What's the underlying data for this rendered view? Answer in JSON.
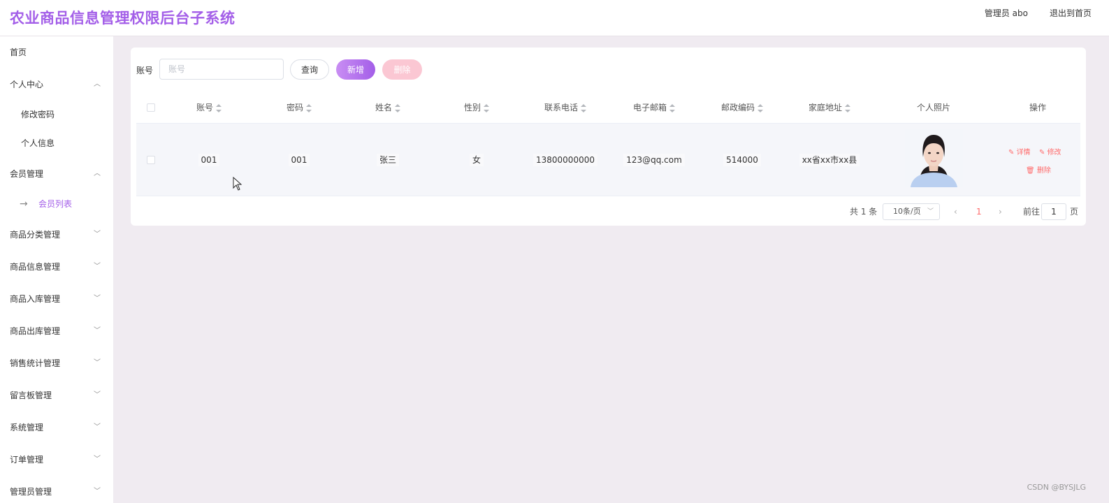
{
  "header": {
    "title": "农业商品信息管理权限后台子系统",
    "user": "管理员 abo",
    "logout": "退出到首页"
  },
  "sidebar": {
    "items": [
      {
        "label": "首页"
      },
      {
        "label": "个人中心",
        "children": [
          "修改密码",
          "个人信息"
        ]
      },
      {
        "label": "会员管理",
        "children": [
          "会员列表"
        ]
      },
      {
        "label": "商品分类管理"
      },
      {
        "label": "商品信息管理"
      },
      {
        "label": "商品入库管理"
      },
      {
        "label": "商品出库管理"
      },
      {
        "label": "销售统计管理"
      },
      {
        "label": "留言板管理"
      },
      {
        "label": "系统管理"
      },
      {
        "label": "订单管理"
      },
      {
        "label": "管理员管理"
      }
    ],
    "active_item": "会员列表"
  },
  "search": {
    "label": "账号",
    "placeholder": "账号",
    "value": "",
    "query_label": "查询",
    "add_label": "新增",
    "delete_label": "删除"
  },
  "table": {
    "columns": [
      "账号",
      "密码",
      "姓名",
      "性别",
      "联系电话",
      "电子邮箱",
      "邮政编码",
      "家庭地址",
      "个人照片",
      "操作"
    ],
    "rows": [
      {
        "account": "001",
        "password": "001",
        "name": "张三",
        "gender": "女",
        "phone": "13800000000",
        "email": "123@qq.com",
        "postcode": "514000",
        "address": "xx省xx市xx县",
        "actions": {
          "detail": "详情",
          "edit": "修改",
          "delete": "删除"
        }
      }
    ]
  },
  "pagination": {
    "total": "共 1 条",
    "page_size": "10条/页",
    "current_page": "1",
    "goto_prefix": "前往",
    "goto_value": "1",
    "goto_suffix": "页"
  },
  "watermark": "CSDN @BYSJLG",
  "colors": {
    "accent": "#a35ee8",
    "danger": "#ff6b6b",
    "delete_button": "#fbc7d3",
    "background": "#f0ebf1"
  },
  "icons": [
    "chevron-up-icon",
    "chevron-down-icon",
    "arrow-right-icon",
    "sort-caret-icon",
    "edit-icon",
    "trash-icon",
    "chevron-left-icon",
    "chevron-right-icon"
  ]
}
